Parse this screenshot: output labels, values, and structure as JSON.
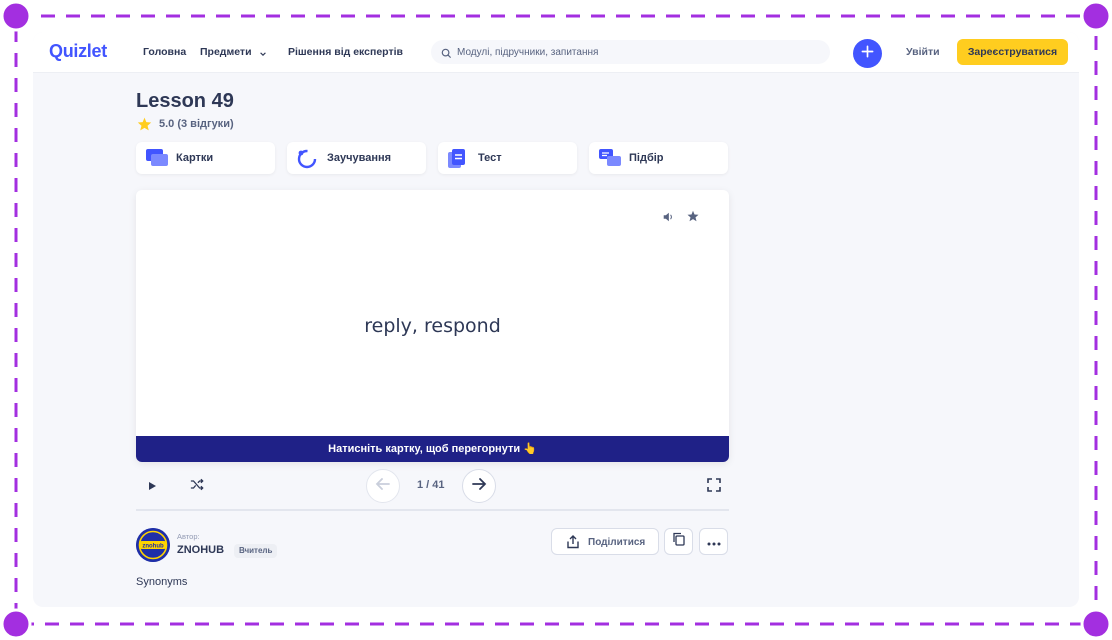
{
  "header": {
    "logo": "Quizlet",
    "nav": {
      "home": "Головна",
      "subjects": "Предмети",
      "expert_solutions": "Рішення від експертів"
    },
    "search_placeholder": "Модулі, підручники, запитання",
    "login_label": "Увійти",
    "signup_label": "Зареєструватися"
  },
  "set": {
    "title": "Lesson 49",
    "rating": "5.0 (3 відгуки)"
  },
  "modes": [
    {
      "label": "Картки",
      "icon": "flashcards-icon"
    },
    {
      "label": "Заучування",
      "icon": "learn-icon"
    },
    {
      "label": "Тест",
      "icon": "test-icon"
    },
    {
      "label": "Підбір",
      "icon": "match-icon"
    }
  ],
  "card": {
    "term": "reply, respond",
    "flip_hint": "Натисніть картку, щоб перегорнути 👆"
  },
  "controls": {
    "counter": "1 / 41"
  },
  "author": {
    "caption": "Автор:",
    "name": "ZNOHUB",
    "badge": "Вчитель",
    "avatar_text": "znohub"
  },
  "actions": {
    "share_label": "Поділитися"
  },
  "description": "Synonyms",
  "colors": {
    "brand": "#4255ff",
    "signup": "#ffcd1f",
    "flip_bar": "#1f2187",
    "frame": "#a32fe0"
  }
}
